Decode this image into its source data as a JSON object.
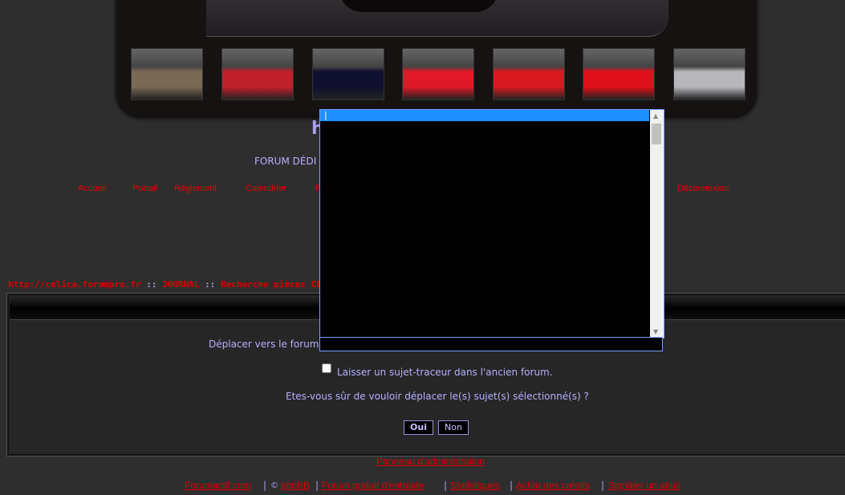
{
  "header": {
    "title": "h",
    "subtitle": "FORUM DÉDI"
  },
  "thumbnails": [
    {
      "name": "celica-1",
      "color": "#7a6a55"
    },
    {
      "name": "celica-2",
      "color": "#c0202a"
    },
    {
      "name": "celica-3",
      "color": "#101030"
    },
    {
      "name": "celica-4",
      "color": "#e01828"
    },
    {
      "name": "celica-5",
      "color": "#d81a20"
    },
    {
      "name": "celica-6",
      "color": "#e0101a"
    },
    {
      "name": "celica-7",
      "color": "#b8b8bc"
    }
  ],
  "nav": [
    "Accueil",
    "Portail",
    "Réglement",
    "Calendrier",
    "F",
    "Déconnexion"
  ],
  "breadcrumb": {
    "items": [
      "http://celica.forumpro.fr",
      "JOURNAL",
      "Recherche pièces CELIC"
    ],
    "sep": "::"
  },
  "form": {
    "move_label": "Déplacer vers le forum",
    "leave_shadow": "Laisser un sujet-traceur dans l'ancien forum.",
    "leave_shadow_checked": false,
    "confirm": "Etes-vous sûr de vouloir déplacer le(s) sujet(s) sélectionné(s) ?",
    "yes": "Oui",
    "no": "Non"
  },
  "dropdown": {
    "selected": "|"
  },
  "footer": {
    "admin": "Panneau d'administration",
    "links": [
      "Forumactif.com",
      "phpBB",
      "Forum gratuit d'entraide",
      "Statistiques",
      "Achat des crédits",
      "Signaler un abus"
    ],
    "copyright": "©"
  },
  "colors": {
    "accent": "#a9a0f0",
    "link": "#dd0000",
    "selection": "#1e90ff"
  }
}
